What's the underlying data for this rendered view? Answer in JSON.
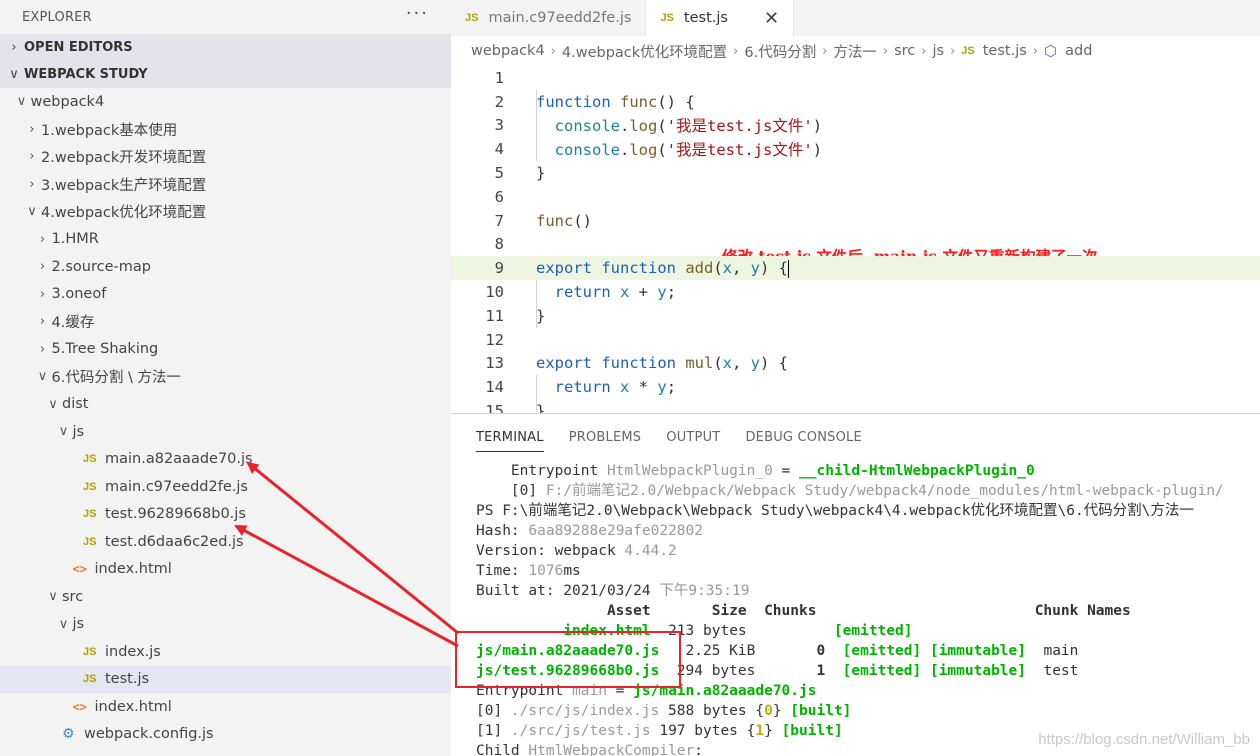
{
  "explorer": {
    "title": "EXPLORER",
    "more": "···",
    "sections": {
      "open_editors": "OPEN EDITORS",
      "workspace": "WEBPACK STUDY"
    },
    "tree": [
      {
        "label": "webpack4",
        "depth": 1,
        "chev": "∨",
        "icon": ""
      },
      {
        "label": "1.webpack基本使用",
        "depth": 2,
        "chev": "›",
        "icon": ""
      },
      {
        "label": "2.webpack开发环境配置",
        "depth": 2,
        "chev": "›",
        "icon": ""
      },
      {
        "label": "3.webpack生产环境配置",
        "depth": 2,
        "chev": "›",
        "icon": ""
      },
      {
        "label": "4.webpack优化环境配置",
        "depth": 2,
        "chev": "∨",
        "icon": ""
      },
      {
        "label": "1.HMR",
        "depth": 3,
        "chev": "›",
        "icon": ""
      },
      {
        "label": "2.source-map",
        "depth": 3,
        "chev": "›",
        "icon": ""
      },
      {
        "label": "3.oneof",
        "depth": 3,
        "chev": "›",
        "icon": ""
      },
      {
        "label": "4.缓存",
        "depth": 3,
        "chev": "›",
        "icon": ""
      },
      {
        "label": "5.Tree Shaking",
        "depth": 3,
        "chev": "›",
        "icon": ""
      },
      {
        "label": "6.代码分割 \\ 方法一",
        "depth": 3,
        "chev": "∨",
        "icon": ""
      },
      {
        "label": "dist",
        "depth": 4,
        "chev": "∨",
        "icon": ""
      },
      {
        "label": "js",
        "depth": 5,
        "chev": "∨",
        "icon": ""
      },
      {
        "label": "main.a82aaade70.js",
        "depth": 6,
        "chev": "",
        "icon": "JS"
      },
      {
        "label": "main.c97eedd2fe.js",
        "depth": 6,
        "chev": "",
        "icon": "JS"
      },
      {
        "label": "test.96289668b0.js",
        "depth": 6,
        "chev": "",
        "icon": "JS"
      },
      {
        "label": "test.d6daa6c2ed.js",
        "depth": 6,
        "chev": "",
        "icon": "JS"
      },
      {
        "label": "index.html",
        "depth": 5,
        "chev": "",
        "icon": "<>"
      },
      {
        "label": "src",
        "depth": 4,
        "chev": "∨",
        "icon": ""
      },
      {
        "label": "js",
        "depth": 5,
        "chev": "∨",
        "icon": ""
      },
      {
        "label": "index.js",
        "depth": 6,
        "chev": "",
        "icon": "JS"
      },
      {
        "label": "test.js",
        "depth": 6,
        "chev": "",
        "icon": "JS",
        "selected": true
      },
      {
        "label": "index.html",
        "depth": 5,
        "chev": "",
        "icon": "<>"
      },
      {
        "label": "webpack.config.js",
        "depth": 4,
        "chev": "",
        "icon": "⚙"
      }
    ]
  },
  "tabs": [
    {
      "icon": "JS",
      "label": "main.c97eedd2fe.js",
      "active": false
    },
    {
      "icon": "JS",
      "label": "test.js",
      "active": true,
      "close": "✕"
    }
  ],
  "breadcrumb": {
    "parts": [
      "webpack4",
      "4.webpack优化环境配置",
      "6.代码分割",
      "方法一",
      "src",
      "js"
    ],
    "file_icon": "JS",
    "file": "test.js",
    "symbol_icon": "⬡",
    "symbol": "add",
    "sep": "›"
  },
  "code_lines": [
    {
      "n": "1",
      "tokens": []
    },
    {
      "n": "2",
      "tokens": [
        [
          "kw",
          "function "
        ],
        [
          "fn",
          "func"
        ],
        [
          "pl",
          "() {"
        ]
      ]
    },
    {
      "n": "3",
      "tokens": [
        [
          "pl",
          "  "
        ],
        [
          "obj",
          "console"
        ],
        [
          "pl",
          "."
        ],
        [
          "fn",
          "log"
        ],
        [
          "pl",
          "("
        ],
        [
          "str",
          "'我是test.js文件'"
        ],
        [
          "pl",
          ")"
        ]
      ]
    },
    {
      "n": "4",
      "tokens": [
        [
          "pl",
          "  "
        ],
        [
          "obj",
          "console"
        ],
        [
          "pl",
          "."
        ],
        [
          "fn",
          "log"
        ],
        [
          "pl",
          "("
        ],
        [
          "str",
          "'我是test.js文件'"
        ],
        [
          "pl",
          ")"
        ]
      ]
    },
    {
      "n": "5",
      "tokens": [
        [
          "pl",
          "}"
        ]
      ]
    },
    {
      "n": "6",
      "tokens": []
    },
    {
      "n": "7",
      "tokens": [
        [
          "fn",
          "func"
        ],
        [
          "pl",
          "()"
        ]
      ]
    },
    {
      "n": "8",
      "tokens": []
    },
    {
      "n": "9",
      "tokens": [
        [
          "kw",
          "export function "
        ],
        [
          "fn",
          "add"
        ],
        [
          "pl",
          "("
        ],
        [
          "obj",
          "x"
        ],
        [
          "pl",
          ", "
        ],
        [
          "obj",
          "y"
        ],
        [
          "pl",
          ") {"
        ]
      ],
      "current": true
    },
    {
      "n": "10",
      "tokens": [
        [
          "pl",
          "  "
        ],
        [
          "kw",
          "return "
        ],
        [
          "obj",
          "x"
        ],
        [
          "pl",
          " + "
        ],
        [
          "obj",
          "y"
        ],
        [
          "pl",
          ";"
        ]
      ]
    },
    {
      "n": "11",
      "tokens": [
        [
          "pl",
          "}"
        ]
      ]
    },
    {
      "n": "12",
      "tokens": []
    },
    {
      "n": "13",
      "tokens": [
        [
          "kw",
          "export function "
        ],
        [
          "fn",
          "mul"
        ],
        [
          "pl",
          "("
        ],
        [
          "obj",
          "x"
        ],
        [
          "pl",
          ", "
        ],
        [
          "obj",
          "y"
        ],
        [
          "pl",
          ") {"
        ]
      ]
    },
    {
      "n": "14",
      "tokens": [
        [
          "pl",
          "  "
        ],
        [
          "kw",
          "return "
        ],
        [
          "obj",
          "x"
        ],
        [
          "pl",
          " * "
        ],
        [
          "obj",
          "y"
        ],
        [
          "pl",
          ";"
        ]
      ]
    },
    {
      "n": "15",
      "tokens": [
        [
          "pl",
          "}"
        ]
      ]
    }
  ],
  "annotation": "修改 test.js 文件后, main.js 文件又重新构建了一次",
  "panel_tabs": [
    "TERMINAL",
    "PROBLEMS",
    "OUTPUT",
    "DEBUG CONSOLE"
  ],
  "terminal_lines": [
    [
      [
        "pl",
        "    Entrypoint "
      ],
      [
        "dim",
        "HtmlWebpackPlugin_0"
      ],
      [
        "pl",
        " = "
      ],
      [
        "green",
        "__child-HtmlWebpackPlugin_0"
      ]
    ],
    [
      [
        "pl",
        "    [0] "
      ],
      [
        "dim",
        "F:/前端笔记2.0/Webpack/Webpack Study/webpack4/node_modules/html-webpack-plugin/"
      ]
    ],
    [
      [
        "pl",
        "PS F:\\前端笔记2.0\\Webpack\\Webpack Study\\webpack4\\4.webpack优化环境配置\\6.代码分割\\方法一"
      ]
    ],
    [
      [
        "pl",
        "Hash: "
      ],
      [
        "dim",
        "6aa89288e29afe022802"
      ]
    ],
    [
      [
        "pl",
        "Version: webpack "
      ],
      [
        "dim",
        "4.44.2"
      ]
    ],
    [
      [
        "pl",
        "Time: "
      ],
      [
        "dim",
        "1076"
      ],
      [
        "pl",
        "ms"
      ]
    ],
    [
      [
        "pl",
        "Built at: 2021/03/24 "
      ],
      [
        "dim",
        "下午9:35:19"
      ]
    ],
    [
      [
        "dimb",
        "               Asset       Size  Chunks                         Chunk Names"
      ]
    ],
    [
      [
        "pl",
        "          "
      ],
      [
        "green",
        "index.html"
      ],
      [
        "pl",
        "  213 bytes          "
      ],
      [
        "green",
        "[emitted]"
      ]
    ],
    [
      [
        "green",
        "js/main.a82aaade70.js"
      ],
      [
        "pl",
        "   2.25 KiB       "
      ],
      [
        "bold",
        "0"
      ],
      [
        "pl",
        "  "
      ],
      [
        "green",
        "[emitted] [immutable]"
      ],
      [
        "pl",
        "  main"
      ]
    ],
    [
      [
        "green",
        "js/test.96289668b0.js"
      ],
      [
        "pl",
        "  294 bytes       "
      ],
      [
        "bold",
        "1"
      ],
      [
        "pl",
        "  "
      ],
      [
        "green",
        "[emitted] [immutable]"
      ],
      [
        "pl",
        "  test"
      ]
    ],
    [
      [
        "pl",
        "Entrypoint "
      ],
      [
        "dim",
        "main"
      ],
      [
        "pl",
        " = "
      ],
      [
        "green",
        "js/main.a82aaade70.js"
      ]
    ],
    [
      [
        "pl",
        "[0] "
      ],
      [
        "dim",
        "./src/js/index.js"
      ],
      [
        "pl",
        " 588 bytes {"
      ],
      [
        "yellow",
        "0"
      ],
      [
        "pl",
        "} "
      ],
      [
        "green",
        "[built]"
      ]
    ],
    [
      [
        "pl",
        "[1] "
      ],
      [
        "dim",
        "./src/js/test.js"
      ],
      [
        "pl",
        " 197 bytes {"
      ],
      [
        "yellow",
        "1"
      ],
      [
        "pl",
        "} "
      ],
      [
        "green",
        "[built]"
      ]
    ],
    [
      [
        "pl",
        "Child "
      ],
      [
        "dim",
        "HtmlWebpackCompiler"
      ],
      [
        "pl",
        ":"
      ]
    ]
  ],
  "watermark": "https://blog.csdn.net/William_bb",
  "colors": {
    "annotation": "#ff1a1a",
    "highlight_box": "#e8232a",
    "arrow": "#e8232a"
  }
}
